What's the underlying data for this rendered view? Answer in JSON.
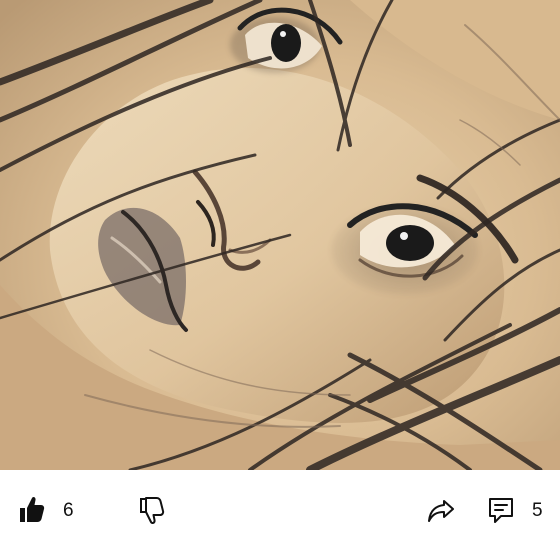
{
  "media": {
    "artwork_name": "pencil-portrait-sketch",
    "colors": {
      "paper": "#d7b890",
      "graphite": "#2b2b2b"
    }
  },
  "actions": {
    "like": {
      "icon": "thumbs-up-filled-icon",
      "count": "6"
    },
    "dislike": {
      "icon": "thumbs-down-outline-icon"
    },
    "share": {
      "icon": "share-arrow-icon"
    },
    "comment": {
      "icon": "comment-icon",
      "count": "5"
    }
  }
}
